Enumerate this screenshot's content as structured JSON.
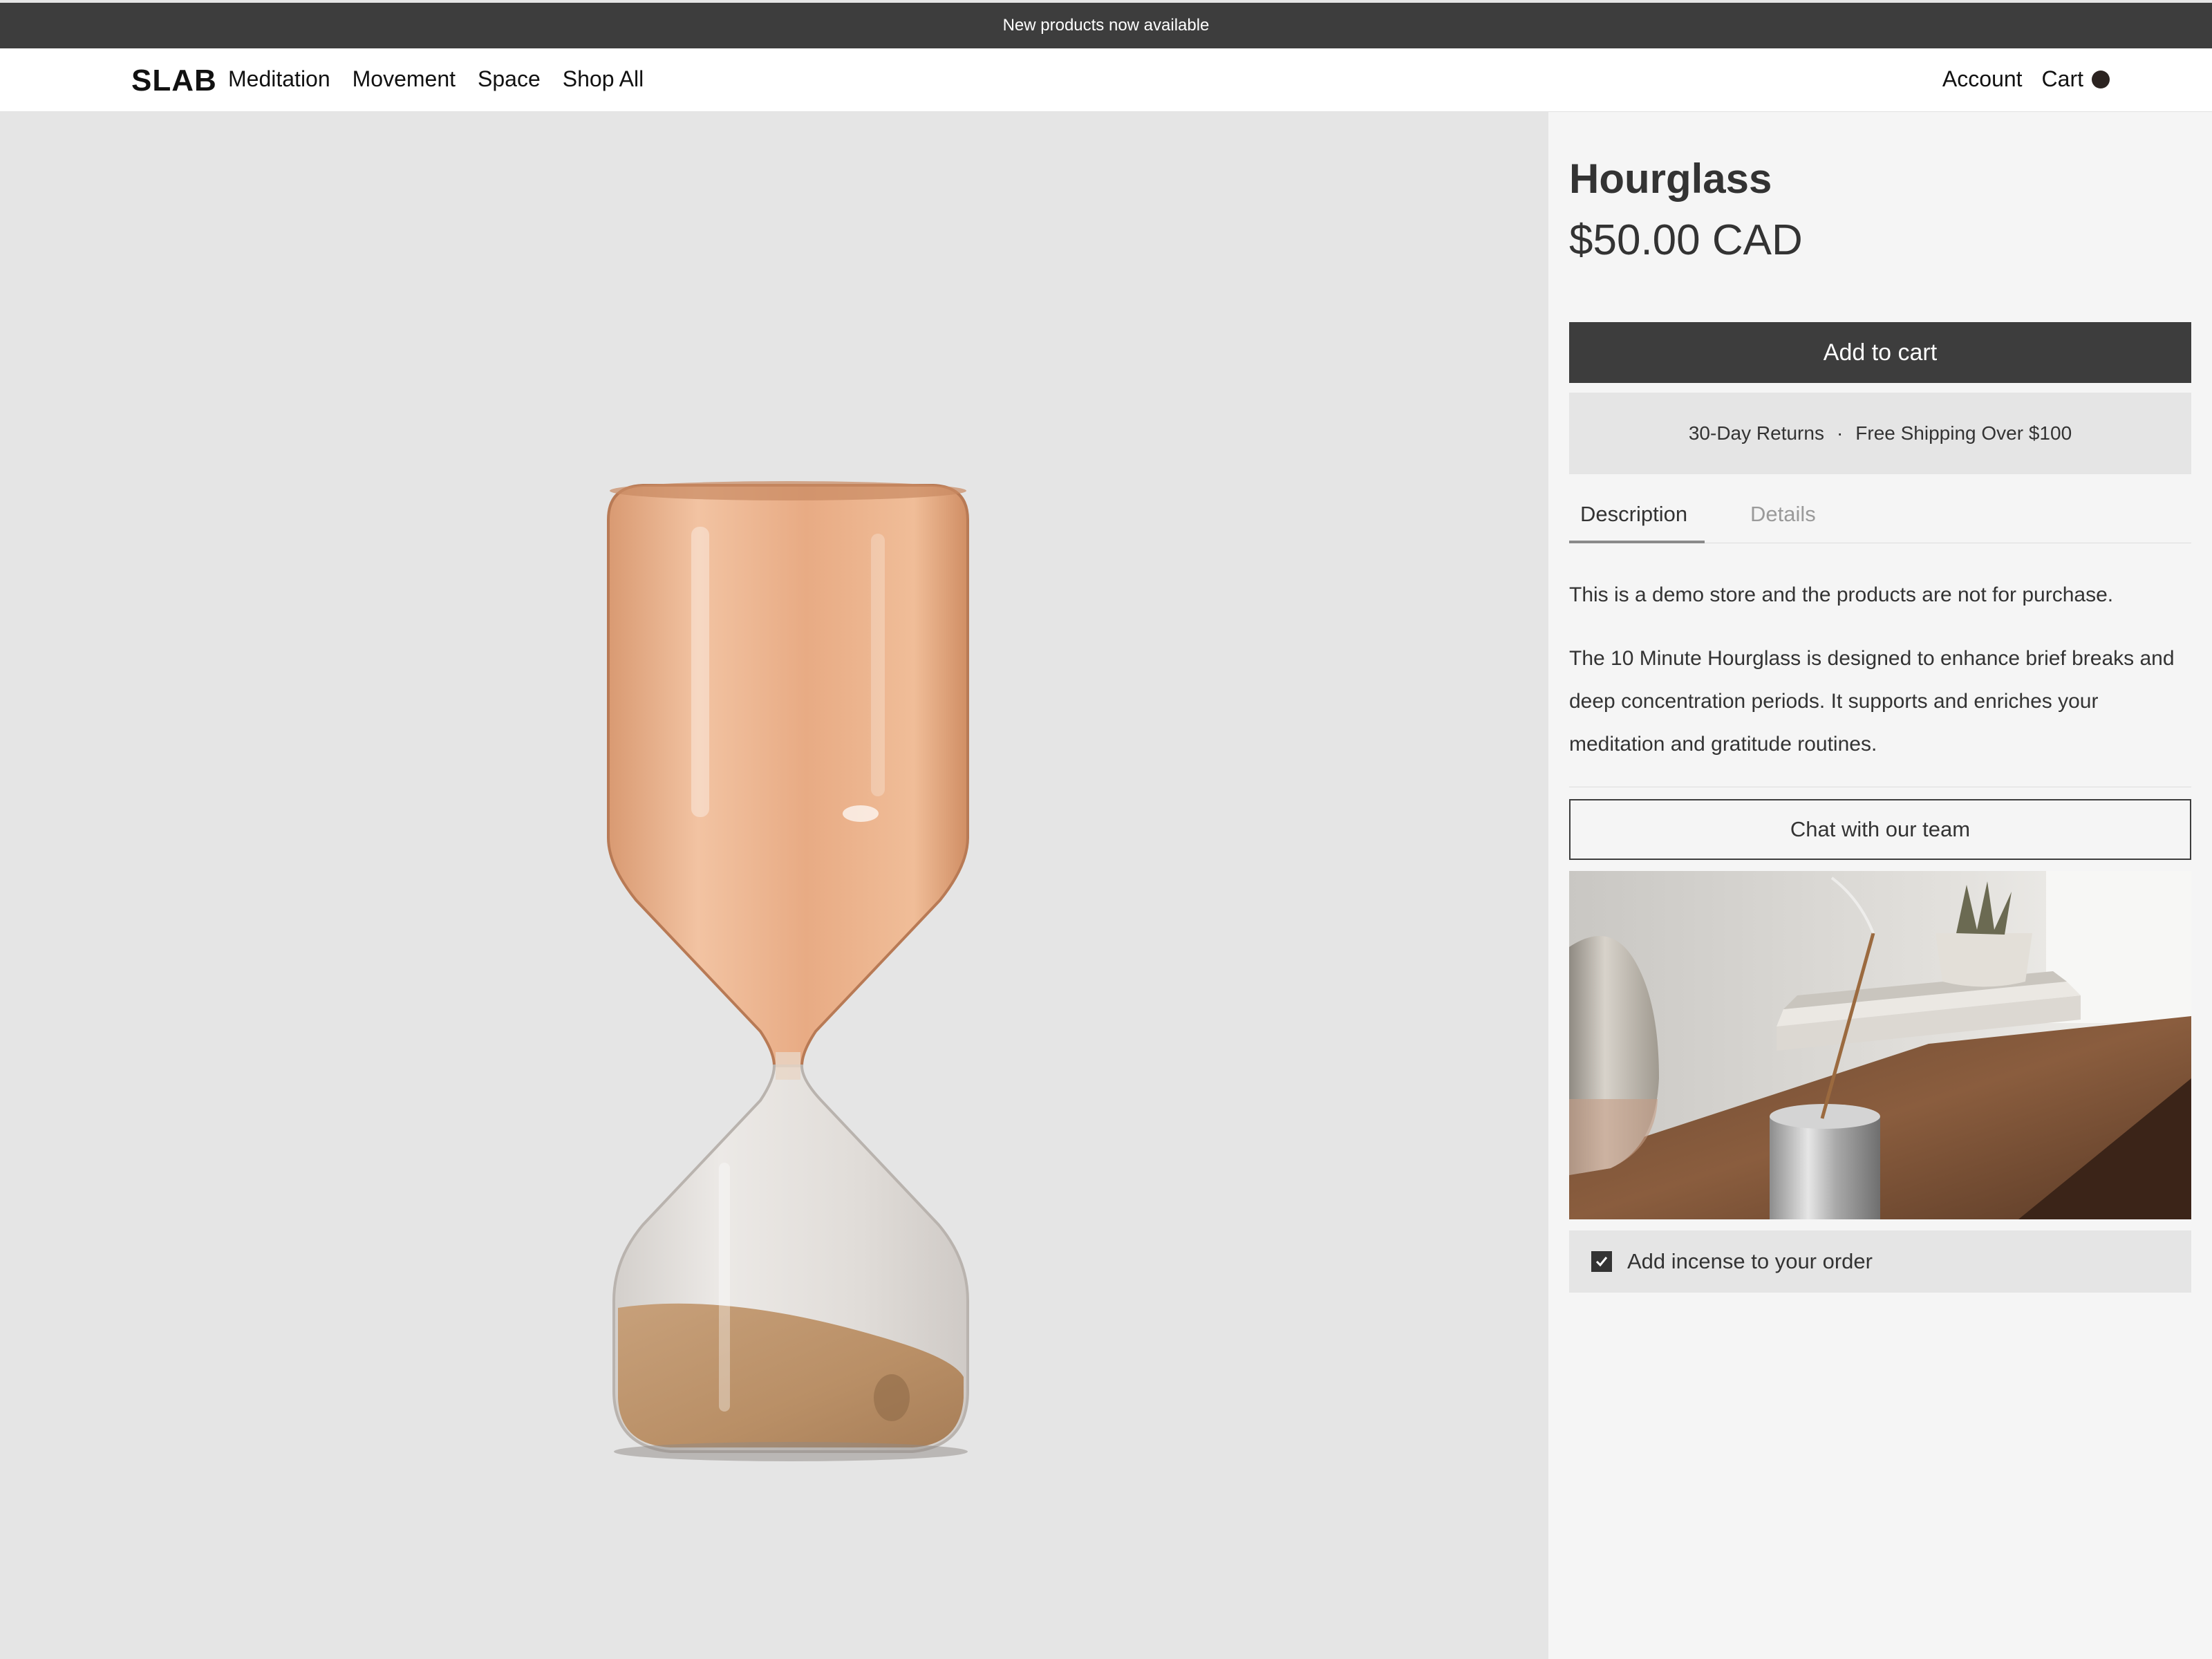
{
  "announcement": "New products now available",
  "header": {
    "logo": "SLAB",
    "nav": [
      "Meditation",
      "Movement",
      "Space",
      "Shop All"
    ],
    "account_label": "Account",
    "cart_label": "Cart"
  },
  "product": {
    "title": "Hourglass",
    "price": "$50.00 CAD",
    "add_to_cart_label": "Add to cart",
    "perks": [
      "30-Day Returns",
      "·",
      "Free Shipping Over $100"
    ],
    "tabs": [
      "Description",
      "Details"
    ],
    "active_tab": "Description",
    "description": [
      "This is a demo store and the products are not for purchase.",
      "The 10 Minute Hourglass is designed to enhance brief breaks and deep concentration periods. It supports and enriches your meditation and gratitude routines."
    ],
    "chat_label": "Chat with our team",
    "addon_label": "Add incense to your order",
    "addon_checked": true
  },
  "colors": {
    "dark": "#3d3d3d",
    "gallery_bg": "#e5e5e5",
    "panel_bg": "#f5f5f5",
    "glass_tint": "#e8b08a",
    "sand": "#c29a6e"
  }
}
